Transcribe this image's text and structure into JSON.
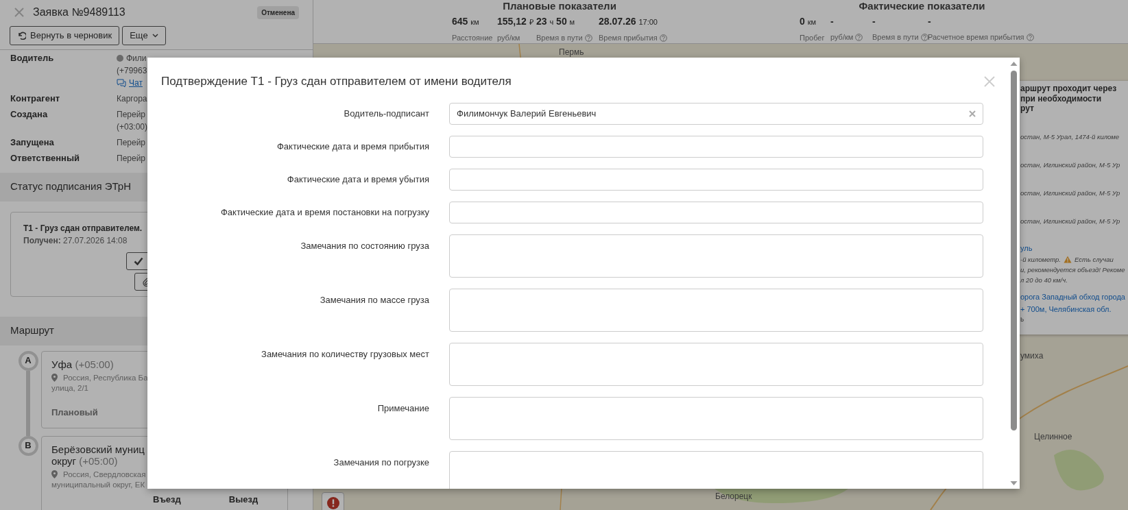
{
  "order": {
    "title": "Заявка №9489113",
    "status": "Отменена",
    "actions": [
      {
        "kind": "revert",
        "label": "Вернуть в черновик"
      },
      {
        "kind": "dropdown",
        "label": "Еще"
      }
    ],
    "fields": [
      {
        "kind": "driver",
        "label": "Водитель",
        "lines": [
          "Фили",
          "(+79963"
        ],
        "chat": "Чат"
      },
      {
        "kind": "text",
        "label": "Контрагент",
        "lines": [
          "Каргора"
        ]
      },
      {
        "kind": "text",
        "label": "Создана",
        "lines": [
          "Перейр",
          "(+03:00)"
        ]
      },
      {
        "kind": "text",
        "label": "Запущена",
        "lines": [
          "Перейр"
        ]
      },
      {
        "kind": "text",
        "label": "Ответственный",
        "lines": [
          "Перейр"
        ]
      }
    ]
  },
  "etrn": {
    "title": "Статус подписания ЭТрН",
    "doc_title": "Т1 - Груз сдан отправителем.",
    "received": "**Получен:** 27.07.2026 14:08"
  },
  "route": {
    "title": "Маршрут",
    "points": [
      {
        "marker": "A",
        "city_lines": [
          "Уфа"
        ],
        "tz": "(+05:00)",
        "address_lines": [
          "Россия, Республика Ба",
          "улица, 2/1"
        ],
        "type": "Плановый"
      },
      {
        "marker": "B",
        "city_lines": [
          "Берёзовский муниц",
          "округ"
        ],
        "tz": "(+05:00)",
        "address_lines": [
          "Россия, Свердловская",
          "муниципальный округ, ЕК"
        ],
        "columns": [
          "Въезд",
          "Выезд"
        ]
      }
    ]
  },
  "planned": {
    "title": "Плановые показатели",
    "metrics": [
      {
        "parts": [
          {
            "text": "645",
            "unit": false
          },
          {
            "text": "км",
            "unit": true
          }
        ],
        "label": "Расстояние",
        "help": false
      },
      {
        "parts": [
          {
            "text": "155,12",
            "unit": false
          },
          {
            "text": "₽",
            "unit": true
          }
        ],
        "label": "руб/км",
        "help": false
      },
      {
        "parts": [
          {
            "text": "23",
            "unit": false
          },
          {
            "text": "ч",
            "unit": true
          },
          {
            "text": "50",
            "unit": false
          },
          {
            "text": "м",
            "unit": true
          }
        ],
        "label": "Время в пути",
        "help": true
      },
      {
        "parts": [
          {
            "text": "28.07.26",
            "unit": false
          },
          {
            "text": "17:00",
            "unit": true
          }
        ],
        "label": "Время прибытия",
        "help": true
      }
    ]
  },
  "actual": {
    "title": "Фактические показатели",
    "metrics": [
      {
        "parts": [
          {
            "text": "0",
            "unit": false
          },
          {
            "text": "км",
            "unit": true
          }
        ],
        "label": "Пробег",
        "help": false
      },
      {
        "parts": [
          {
            "text": "-",
            "unit": false
          }
        ],
        "label": "руб/км",
        "help": true
      },
      {
        "parts": [
          {
            "text": "-",
            "unit": false
          }
        ],
        "label": "Время в пути",
        "help": true
      },
      {
        "parts": [
          {
            "text": "-",
            "unit": false
          }
        ],
        "label": "Расчетное время прибытия",
        "help": true
      }
    ]
  },
  "map": {
    "labels": [
      "Пермь",
      "умиха",
      "Целинное",
      "Белорецк"
    ],
    "popup": [
      {
        "kind": "heading",
        "text": "аршрут проходит через"
      },
      {
        "kind": "heading",
        "text": "при необходимости"
      },
      {
        "kind": "heading",
        "text": "рут"
      },
      {
        "kind": "address",
        "text": "остан, М-5 Урал, 1474-й киломе"
      },
      {
        "kind": "address",
        "text": "остан, Иглинский район, М-5 Ур"
      },
      {
        "kind": "address",
        "text": "остан, Иглинский район, М-5 Ур"
      },
      {
        "kind": "address",
        "text": "остан, Иглинский район, М-5 Ур"
      },
      {
        "kind": "link",
        "text": "уль"
      },
      {
        "kind": "note",
        "text": "-й километр.",
        "warning": true,
        "text_after": "Есть случаи"
      },
      {
        "kind": "note",
        "text": "и, рекомендуется объезд! Рекоме"
      },
      {
        "kind": "note",
        "text": "л 20 до 40 км/ч."
      },
      {
        "kind": "link",
        "text": "орога Западный обход города"
      },
      {
        "kind": "link",
        "text": "+ 700м, Челябинская обл."
      },
      {
        "kind": "small",
        "text": "ь"
      }
    ]
  },
  "modal": {
    "title": "Подтверждение Т1 - Груз сдан отправителем от имени водителя",
    "fields": [
      {
        "kind": "select",
        "label": "Водитель-подписант",
        "value": "Филимончук Валерий Евгеньевич"
      },
      {
        "kind": "input",
        "label": "Фактические дата и время прибытия"
      },
      {
        "kind": "input",
        "label": "Фактические дата и время убытия"
      },
      {
        "kind": "input",
        "label": "Фактические дата и время постановки на погрузку"
      },
      {
        "kind": "textarea",
        "label": "Замечания по состоянию груза"
      },
      {
        "kind": "textarea",
        "label": "Замечания по массе груза"
      },
      {
        "kind": "textarea",
        "label": "Замечания по количеству грузовых мест"
      },
      {
        "kind": "textarea",
        "label": "Примечание"
      },
      {
        "kind": "textarea",
        "label": "Замечания по погрузке"
      }
    ]
  }
}
